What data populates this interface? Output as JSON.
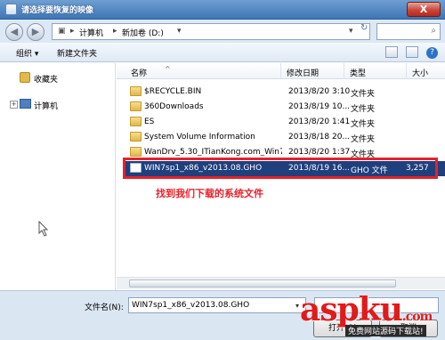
{
  "window": {
    "title": "请选择要恢复的映像",
    "close_glyph": "X"
  },
  "address": {
    "back_glyph": "◀",
    "forward_glyph": "▶",
    "path_separator": "▸",
    "path": [
      "计算机",
      "新加卷 (D:)"
    ],
    "dropdown_glyph": "▾",
    "refresh_glyph": "↻",
    "search_glyph": "⌕"
  },
  "toolbar": {
    "organize": "组织 ▾",
    "new_folder": "新建文件夹",
    "help_glyph": "?"
  },
  "nav": {
    "items": [
      {
        "label": "收藏夹",
        "icon": "star-folder-icon"
      },
      {
        "label": "计算机",
        "icon": "computer-icon"
      }
    ],
    "expander_glyph": "+"
  },
  "columns": {
    "name": "名称",
    "date": "修改日期",
    "type": "类型",
    "size": "大小",
    "sort_glyph": "^"
  },
  "files": [
    {
      "name": "$RECYCLE.BIN",
      "date": "2013/8/20 3:10",
      "type": "文件夹",
      "size": ""
    },
    {
      "name": "360Downloads",
      "date": "2013/8/19 10...",
      "type": "文件夹",
      "size": ""
    },
    {
      "name": "ES",
      "date": "2013/8/20 1:41",
      "type": "文件夹",
      "size": ""
    },
    {
      "name": "System Volume Information",
      "date": "2013/8/18 20...",
      "type": "文件夹",
      "size": ""
    },
    {
      "name": "WanDrv_5.30_ITianKong.com_Win7...",
      "date": "2013/8/20 1:37",
      "type": "文件夹",
      "size": ""
    },
    {
      "name": "WIN7sp1_x86_v2013.08.GHO",
      "date": "2013/8/19 16...",
      "type": "GHO 文件",
      "size": "3,257"
    }
  ],
  "annotation": "找到我们下载的系统文件",
  "filename": {
    "label": "文件名(N):",
    "value": "WIN7sp1_x86_v2013.08.GHO",
    "dropdown_glyph": "▾"
  },
  "buttons": {
    "open": "打开(O)",
    "cancel": "取消"
  },
  "watermark": {
    "text": "aspku",
    "suffix": ".com",
    "sub": "免费网站源码下载站!"
  },
  "colors": {
    "selection": "#1f3f7d",
    "annotation_red": "#e8202a",
    "titlebar": "#3f75b5"
  }
}
